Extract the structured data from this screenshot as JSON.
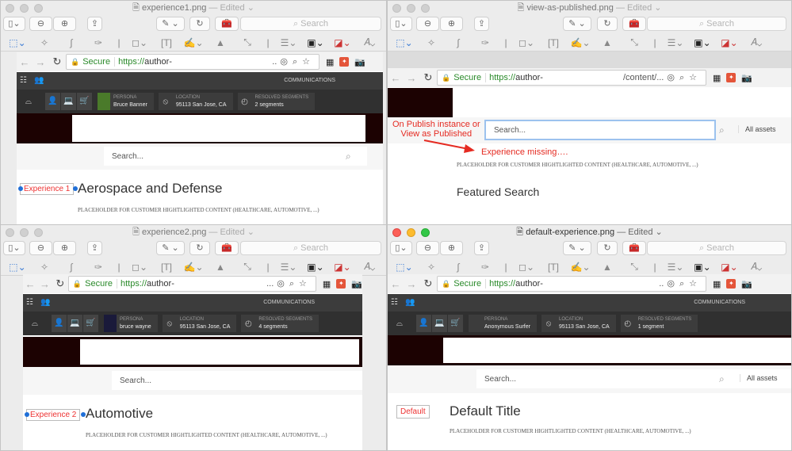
{
  "edited_label": "— Edited",
  "preview_search_placeholder": "Search",
  "colors": {
    "annotation": "#e52b22",
    "experience_handle": "#1f6fd8",
    "site_header": "#1c0202",
    "secure": "#2a8a2a"
  },
  "browser": {
    "secure_label": "Secure",
    "url_prefix": "https://",
    "url_host": "author-",
    "search_placeholder": "Search...",
    "all_assets": "All assets",
    "communications": "COMMUNICATIONS",
    "persona_label": "PERSONA",
    "location_label": "LOCATION",
    "segments_label": "RESOLVED SEGMENTS"
  },
  "windows": [
    {
      "title": "experience1.png",
      "url_suffix": "..",
      "persona": "Bruce Banner",
      "location": "95113 San Jose, CA",
      "segments": "2 segments",
      "experience_label": "Experience 1",
      "page_title": "Aerospace and Defense",
      "placeholder": "PLACEHOLDER FOR CUSTOMER HIGHTLIGHTED CONTENT (HEALTHCARE, AUTOMOTIVE, ...)"
    },
    {
      "title": "view-as-published.png",
      "url_suffix": "/content/...",
      "annotation": "On Publish instance or\nView as Published",
      "missing": "Experience missing….",
      "placeholder": "PLACEHOLDER FOR CUSTOMER HIGHTLIGHTED CONTENT (HEALTHCARE, AUTOMOTIVE, ...)",
      "section_title": "Featured Search"
    },
    {
      "title": "experience2.png",
      "url_suffix": "...",
      "persona": "bruce wayne",
      "location": "95113 San Jose, CA",
      "segments": "4 segments",
      "experience_label": "Experience 2",
      "page_title": "Automotive",
      "placeholder": "PLACEHOLDER FOR CUSTOMER HIGHTLIGHTED CONTENT (HEALTHCARE, AUTOMOTIVE, ...)"
    },
    {
      "title": "default-experience.png",
      "url_suffix": "..",
      "persona": "Anonymous Surfer",
      "location": "95113 San Jose, CA",
      "segments": "1 segment",
      "experience_label": "Default",
      "page_title": "Default Title",
      "placeholder": "PLACEHOLDER FOR CUSTOMER HIGHTLIGHTED CONTENT (HEALTHCARE, AUTOMOTIVE, ...)"
    }
  ]
}
